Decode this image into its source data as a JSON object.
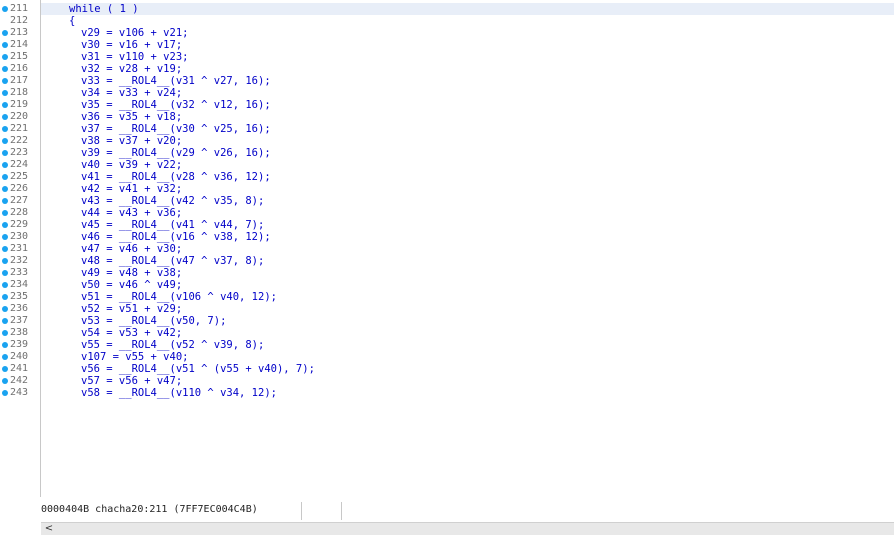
{
  "lines": [
    {
      "n": "211",
      "dot": true,
      "text": "while ( 1 )",
      "indent": 0
    },
    {
      "n": "212",
      "dot": false,
      "text": "{",
      "indent": 0
    },
    {
      "n": "213",
      "dot": true,
      "text": "v29 = v106 + v21;",
      "indent": 1
    },
    {
      "n": "214",
      "dot": true,
      "text": "v30 = v16 + v17;",
      "indent": 1
    },
    {
      "n": "215",
      "dot": true,
      "text": "v31 = v110 + v23;",
      "indent": 1
    },
    {
      "n": "216",
      "dot": true,
      "text": "v32 = v28 + v19;",
      "indent": 1
    },
    {
      "n": "217",
      "dot": true,
      "text": "v33 = __ROL4__(v31 ^ v27, 16);",
      "indent": 1
    },
    {
      "n": "218",
      "dot": true,
      "text": "v34 = v33 + v24;",
      "indent": 1
    },
    {
      "n": "219",
      "dot": true,
      "text": "v35 = __ROL4__(v32 ^ v12, 16);",
      "indent": 1
    },
    {
      "n": "220",
      "dot": true,
      "text": "v36 = v35 + v18;",
      "indent": 1
    },
    {
      "n": "221",
      "dot": true,
      "text": "v37 = __ROL4__(v30 ^ v25, 16);",
      "indent": 1
    },
    {
      "n": "222",
      "dot": true,
      "text": "v38 = v37 + v20;",
      "indent": 1
    },
    {
      "n": "223",
      "dot": true,
      "text": "v39 = __ROL4__(v29 ^ v26, 16);",
      "indent": 1
    },
    {
      "n": "224",
      "dot": true,
      "text": "v40 = v39 + v22;",
      "indent": 1
    },
    {
      "n": "225",
      "dot": true,
      "text": "v41 = __ROL4__(v28 ^ v36, 12);",
      "indent": 1
    },
    {
      "n": "226",
      "dot": true,
      "text": "v42 = v41 + v32;",
      "indent": 1
    },
    {
      "n": "227",
      "dot": true,
      "text": "v43 = __ROL4__(v42 ^ v35, 8);",
      "indent": 1
    },
    {
      "n": "228",
      "dot": true,
      "text": "v44 = v43 + v36;",
      "indent": 1
    },
    {
      "n": "229",
      "dot": true,
      "text": "v45 = __ROL4__(v41 ^ v44, 7);",
      "indent": 1
    },
    {
      "n": "230",
      "dot": true,
      "text": "v46 = __ROL4__(v16 ^ v38, 12);",
      "indent": 1
    },
    {
      "n": "231",
      "dot": true,
      "text": "v47 = v46 + v30;",
      "indent": 1
    },
    {
      "n": "232",
      "dot": true,
      "text": "v48 = __ROL4__(v47 ^ v37, 8);",
      "indent": 1
    },
    {
      "n": "233",
      "dot": true,
      "text": "v49 = v48 + v38;",
      "indent": 1
    },
    {
      "n": "234",
      "dot": true,
      "text": "v50 = v46 ^ v49;",
      "indent": 1
    },
    {
      "n": "235",
      "dot": true,
      "text": "v51 = __ROL4__(v106 ^ v40, 12);",
      "indent": 1
    },
    {
      "n": "236",
      "dot": true,
      "text": "v52 = v51 + v29;",
      "indent": 1
    },
    {
      "n": "237",
      "dot": true,
      "text": "v53 = __ROL4__(v50, 7);",
      "indent": 1
    },
    {
      "n": "238",
      "dot": true,
      "text": "v54 = v53 + v42;",
      "indent": 1
    },
    {
      "n": "239",
      "dot": true,
      "text": "v55 = __ROL4__(v52 ^ v39, 8);",
      "indent": 1
    },
    {
      "n": "240",
      "dot": true,
      "text": "v107 = v55 + v40;",
      "indent": 1
    },
    {
      "n": "241",
      "dot": true,
      "text": "v56 = __ROL4__(v51 ^ (v55 + v40), 7);",
      "indent": 1
    },
    {
      "n": "242",
      "dot": true,
      "text": "v57 = v56 + v47;",
      "indent": 1
    },
    {
      "n": "243",
      "dot": true,
      "text": "v58 = __ROL4__(v110 ^ v34, 12);",
      "indent": 1
    }
  ],
  "status": {
    "text": "0000404B chacha20:211 (7FF7EC004C4B)"
  },
  "scrollbar": {
    "left_arrow": "<"
  },
  "colors": {
    "line_dot": "#1aa3f0",
    "code_text": "#0000c8",
    "highlight_row": "#e8eef8"
  }
}
